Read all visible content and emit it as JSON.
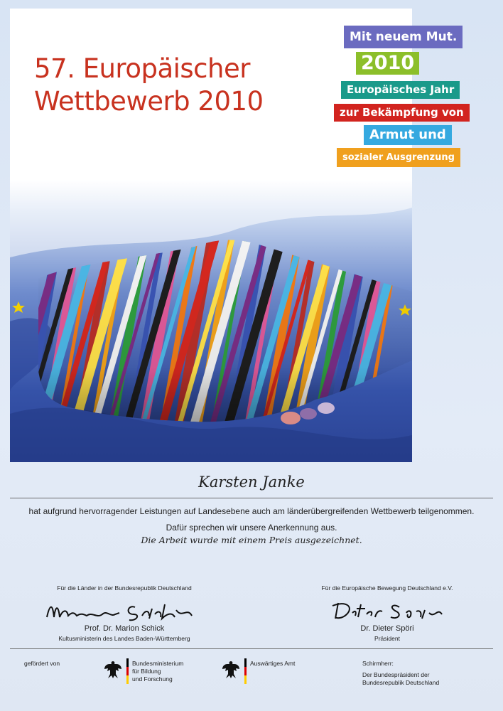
{
  "title": {
    "line1": "57. Europäischer",
    "line2": "Wettbewerb 2010"
  },
  "campaign": {
    "line1": "Mit neuem Mut.",
    "line2": "2010",
    "line3": "Europäisches Jahr",
    "line4": "zur Bekämpfung von",
    "line5": "Armut und",
    "line6": "sozialer Ausgrenzung",
    "colors": {
      "purple": "#6b6bc0",
      "green": "#8cbf2a",
      "teal": "#1a9a8a",
      "red": "#d2241f",
      "blue": "#35a9e0",
      "orange": "#f0a01e"
    }
  },
  "recipient": {
    "name": "Karsten Janke"
  },
  "body": {
    "line1": "hat aufgrund hervorragender Leistungen auf Landesebene auch am länderübergreifenden Wettbewerb teilgenommen.",
    "line2": "Dafür sprechen wir unsere Anerkennung aus.",
    "line3": "Die Arbeit wurde mit einem Preis ausgezeichnet."
  },
  "signatures": {
    "left": {
      "caption": "Für die Länder in der Bundesrepublik Deutschland",
      "name": "Prof. Dr. Marion Schick",
      "role": "Kultusministerin des Landes Baden-Württemberg",
      "signature_text": "Marion Schick"
    },
    "right": {
      "caption": "Für die Europäische Bewegung Deutschland e.V.",
      "name": "Dr. Dieter Spöri",
      "role": "Präsident",
      "signature_text": "Dieter Spöri"
    }
  },
  "footer": {
    "funded_by": "gefördert von",
    "ministry1": {
      "line1": "Bundesministerium",
      "line2": "für Bildung",
      "line3": "und Forschung"
    },
    "ministry2": "Auswärtiges Amt",
    "patron": {
      "line1": "Schirmherr:",
      "line2": "Der Bundespräsident der",
      "line3": "Bundesrepublik Deutschland"
    }
  }
}
